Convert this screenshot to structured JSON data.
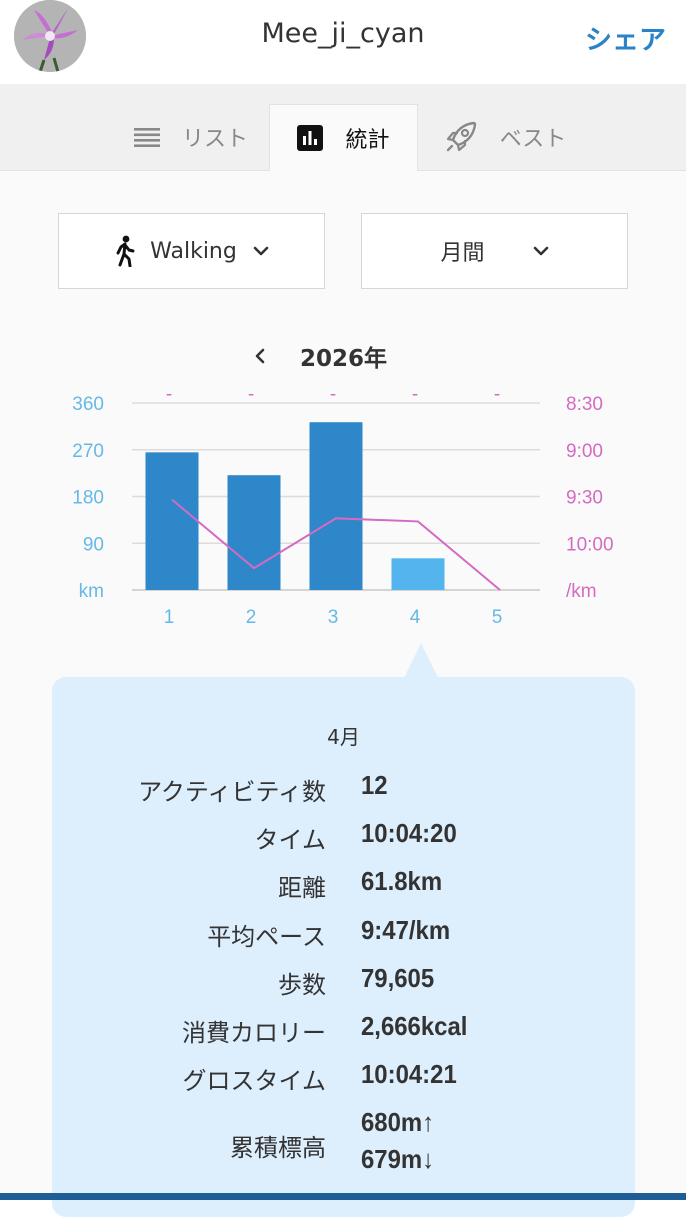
{
  "header": {
    "username": "Mee_ji_cyan",
    "share_label": "シェア",
    "avatar_icon": "orchid-avatar"
  },
  "tabs": [
    {
      "label": "リスト",
      "icon": "list-icon",
      "active": false
    },
    {
      "label": "統計",
      "icon": "bar-chart-icon",
      "active": true
    },
    {
      "label": "ベスト",
      "icon": "rocket-icon",
      "active": false
    }
  ],
  "filters": {
    "activity": {
      "value": "Walking",
      "icon": "walking-person-icon"
    },
    "period": {
      "value": "月間"
    }
  },
  "year_nav": {
    "label": "2026年"
  },
  "chart_data": {
    "type": "bar",
    "categories": [
      "1",
      "2",
      "3",
      "4",
      "5"
    ],
    "series": [
      {
        "values": [
          265,
          221,
          323,
          61,
          0
        ],
        "axis": "left"
      },
      {
        "values": [
          "9:32",
          "10:16",
          "9:44",
          "9:46",
          null
        ],
        "axis": "right",
        "type": "line"
      }
    ],
    "bar_colors": [
      "#2d87c8",
      "#2d87c8",
      "#2d87c8",
      "#54b4ee",
      "#2d87c8"
    ],
    "line_color": "#d46bc2",
    "left_axis": {
      "ticks": [
        "360",
        "270",
        "180",
        "90",
        "km"
      ],
      "range": [
        0,
        360
      ],
      "color": "#66b9e6"
    },
    "right_axis": {
      "ticks": [
        "8:30",
        "9:00",
        "9:30",
        "10:00",
        "/km"
      ],
      "range": [
        "8:30",
        "10:30"
      ],
      "color": "#d46bc2"
    },
    "top_markers": [
      "-",
      "-",
      "-",
      "-",
      "-"
    ],
    "selected_index": 3,
    "grid": true
  },
  "detail": {
    "month": "4月",
    "stats": [
      {
        "label": "アクティビティ数",
        "value": "12"
      },
      {
        "label": "タイム",
        "value": "10:04:20"
      },
      {
        "label": "距離",
        "value": "61.8km"
      },
      {
        "label": "平均ペース",
        "value": "9:47/km"
      },
      {
        "label": "歩数",
        "value": "79,605"
      },
      {
        "label": "消費カロリー",
        "value": "2,666kcal"
      },
      {
        "label": "グロスタイム",
        "value": "10:04:21"
      },
      {
        "label": "累積標高",
        "value": "680m↑",
        "value2": "679m↓"
      }
    ]
  }
}
